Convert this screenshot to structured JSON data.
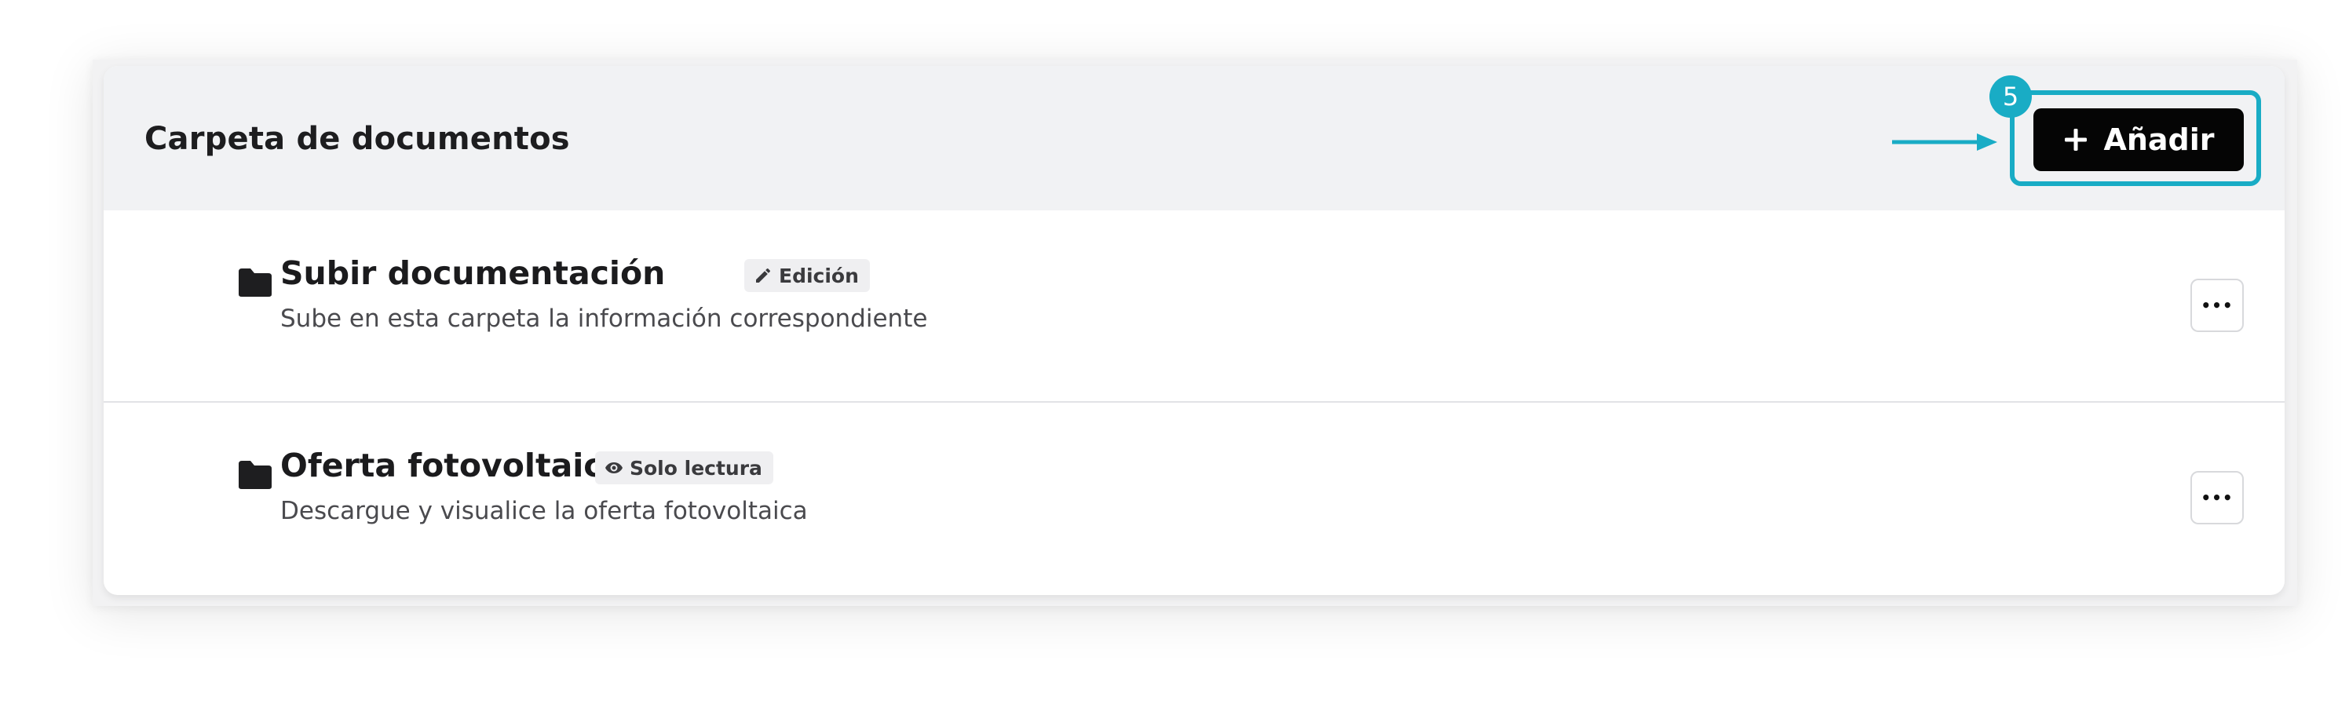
{
  "header": {
    "title": "Carpeta de documentos",
    "add_label": "Añadir",
    "step_number": "5"
  },
  "folders": [
    {
      "title": "Subir documentación",
      "badge": "Edición",
      "badge_icon": "pencil-icon",
      "description": "Sube en esta carpeta la información correspondiente"
    },
    {
      "title": "Oferta fotovoltaica",
      "badge": "Solo lectura",
      "badge_icon": "eye-icon",
      "description": "Descargue y visualice la oferta fotovoltaica"
    }
  ],
  "colors": {
    "accent": "#19acc5",
    "button_bg": "#050505",
    "header_bg": "#f1f2f4"
  }
}
